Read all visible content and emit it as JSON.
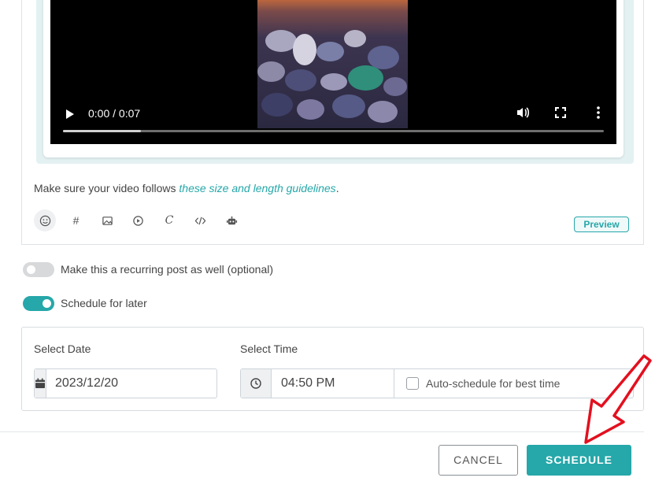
{
  "video": {
    "time_display": "0:00 / 0:07",
    "progress_percent": 14.4
  },
  "editor": {
    "guideline_prefix": "Make sure your video follows ",
    "guideline_link": "these size and length guidelines",
    "guideline_suffix": ".",
    "toolbar": [
      {
        "icon": "emoji-icon"
      },
      {
        "icon": "hashtag-icon",
        "glyph": "#"
      },
      {
        "icon": "image-icon"
      },
      {
        "icon": "video-icon"
      },
      {
        "icon": "canva-icon",
        "glyph": "C"
      },
      {
        "icon": "code-icon"
      },
      {
        "icon": "bot-icon"
      }
    ],
    "preview_label": "Preview"
  },
  "recurring": {
    "label": "Make this a recurring post as well (optional)",
    "enabled": false
  },
  "schedule_later": {
    "label": "Schedule for later",
    "enabled": true
  },
  "schedule": {
    "date_label": "Select Date",
    "date_value": "2023/12/20",
    "time_label": "Select Time",
    "time_value": "04:50 PM",
    "auto_label": "Auto-schedule for best time"
  },
  "actions": {
    "cancel_label": "CANCEL",
    "schedule_label": "SCHEDULE"
  },
  "colors": {
    "accent": "#26a7a9",
    "annotation_arrow": "#e3101f"
  }
}
